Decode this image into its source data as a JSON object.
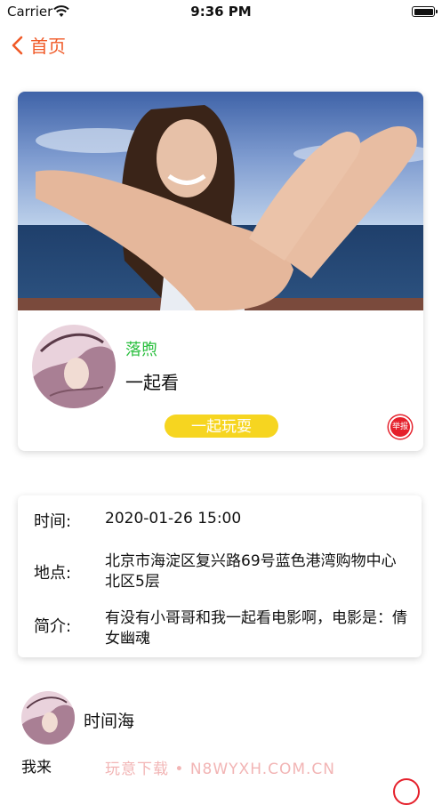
{
  "status_bar": {
    "carrier": "Carrier",
    "time": "9:36 PM"
  },
  "nav": {
    "back_label": "首页"
  },
  "event": {
    "nickname": "落煦",
    "title": "一起看",
    "join_label": "一起玩耍",
    "report_label": "举报"
  },
  "details": {
    "time_label": "时间:",
    "time_value": "2020-01-26 15:00",
    "place_label": "地点:",
    "place_value": "北京市海淀区复兴路69号蓝色港湾购物中心北区5层",
    "intro_label": "简介:",
    "intro_value": "有没有小哥哥和我一起看电影啊，电影是：倩女幽魂"
  },
  "comment": {
    "name": "时间海",
    "text": "我来"
  },
  "watermark": "玩意下载 • N8WYXH.COM.CN",
  "colors": {
    "accent": "#f05a28",
    "nickname": "#2bbf3f",
    "button": "#f6d520",
    "report": "#e5202b"
  }
}
